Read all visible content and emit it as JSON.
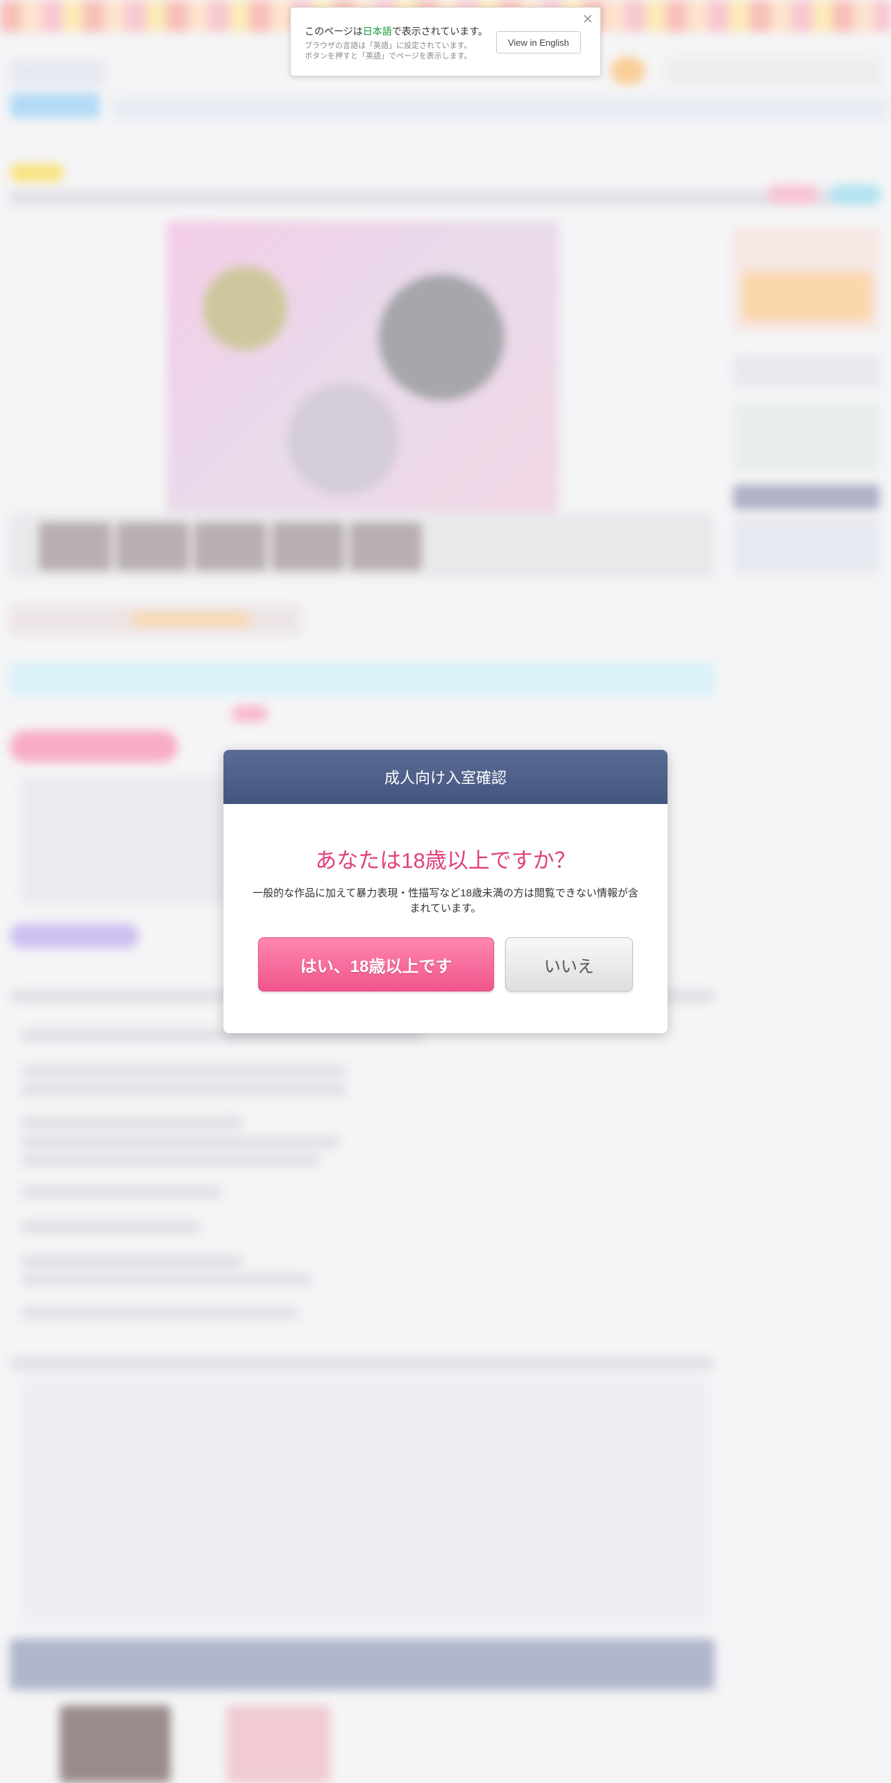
{
  "translate_bar": {
    "message_prefix": "このページは",
    "language": "日本語",
    "message_suffix": "で表示されています。",
    "note_line1": "ブラウザの言語は「英語」に設定されています。",
    "note_line2": "ボタンを押すと「英語」でページを表示します。",
    "view_button": "View in English",
    "close_icon": "close-icon",
    "language_color": "#1a9a3a"
  },
  "age_modal": {
    "title": "成人向け入室確認",
    "question": "あなたは18歳以上ですか？",
    "description": "一般的な作品に加えて暴力表現・性描写など18歳未満の方は閲覧できない情報が含まれています。",
    "yes_button": "はい、18歳以上です",
    "no_button": "いいえ",
    "header_color": "#4a5b86",
    "question_color": "#e0407e",
    "yes_color": "#f55f94"
  }
}
